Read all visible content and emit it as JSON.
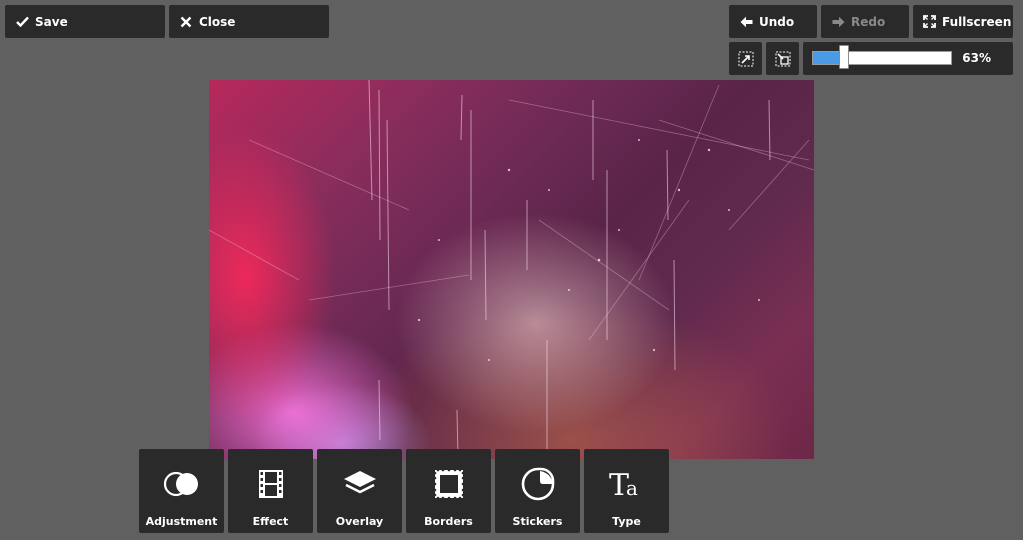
{
  "toolbar": {
    "save_label": "Save",
    "close_label": "Close",
    "undo_label": "Undo",
    "redo_label": "Redo",
    "fullscreen_label": "Fullscreen"
  },
  "zoom": {
    "value_label": "63%",
    "level": 0.23
  },
  "tools": [
    {
      "label": "Adjustment",
      "icon": "adjustment-icon"
    },
    {
      "label": "Effect",
      "icon": "film-strip-icon"
    },
    {
      "label": "Overlay",
      "icon": "layers-icon"
    },
    {
      "label": "Borders",
      "icon": "stamp-border-icon"
    },
    {
      "label": "Stickers",
      "icon": "sticker-icon"
    },
    {
      "label": "Type",
      "icon": "text-type-icon"
    }
  ],
  "colors": {
    "background": "#606060",
    "button": "#2a2a2a",
    "zoom_fill": "#4a9ae6",
    "disabled_text": "#8a8a8a"
  }
}
